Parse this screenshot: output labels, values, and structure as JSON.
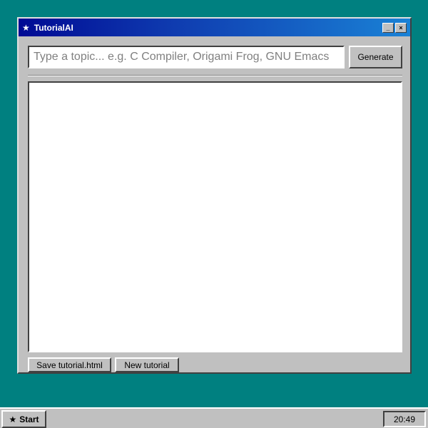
{
  "window": {
    "title": "TutorialAI",
    "icon": "star-icon",
    "minimize_glyph": "_",
    "close_glyph": "×"
  },
  "topic": {
    "value": "",
    "placeholder": "Type a topic... e.g. C Compiler, Origami Frog, GNU Emacs"
  },
  "generate_label": "Generate",
  "output": {
    "content": ""
  },
  "bottom": {
    "save_label": "Save tutorial.html",
    "new_label": "New tutorial"
  },
  "taskbar": {
    "start_icon": "star-icon",
    "start_label": "Start",
    "clock": "20:49"
  },
  "colors": {
    "desktop": "#008080",
    "titlebar_start": "#000a94",
    "titlebar_end": "#1a82d6",
    "chrome": "#c0c0c0"
  }
}
